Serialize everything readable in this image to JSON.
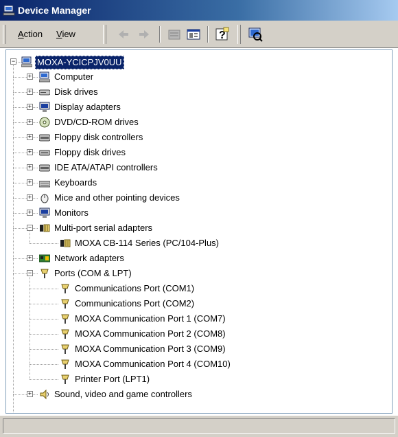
{
  "window": {
    "title": "Device Manager"
  },
  "toolbar": {
    "menu": [
      {
        "label": "Action",
        "accel": "A",
        "rest": "ction"
      },
      {
        "label": "View",
        "accel": "V",
        "rest": "iew"
      }
    ],
    "buttons": [
      "back-icon",
      "forward-icon",
      "up-folder-icon",
      "properties-icon",
      "help-icon",
      "scan-hardware-icon"
    ]
  },
  "tree": {
    "root": {
      "label": "MOXA-YCICPJV0UU",
      "icon": "computer-icon",
      "expanded": true,
      "selected": true
    },
    "nodes": [
      {
        "label": "Computer",
        "icon": "computer-icon",
        "expander": "+"
      },
      {
        "label": "Disk drives",
        "icon": "disk-drive-icon",
        "expander": "+"
      },
      {
        "label": "Display adapters",
        "icon": "monitor-icon",
        "expander": "+"
      },
      {
        "label": "DVD/CD-ROM drives",
        "icon": "cd-rom-icon",
        "expander": "+"
      },
      {
        "label": "Floppy disk controllers",
        "icon": "controller-icon",
        "expander": "+"
      },
      {
        "label": "Floppy disk drives",
        "icon": "floppy-drive-icon",
        "expander": "+"
      },
      {
        "label": "IDE ATA/ATAPI controllers",
        "icon": "controller-icon",
        "expander": "+"
      },
      {
        "label": "Keyboards",
        "icon": "keyboard-icon",
        "expander": "+"
      },
      {
        "label": "Mice and other pointing devices",
        "icon": "mouse-icon",
        "expander": "+"
      },
      {
        "label": "Monitors",
        "icon": "monitor-icon",
        "expander": "+"
      },
      {
        "label": "Multi-port serial adapters",
        "icon": "serial-adapter-icon",
        "expander": "-",
        "children": [
          {
            "label": "MOXA CB-114 Series (PC/104-Plus)",
            "icon": "serial-adapter-icon"
          }
        ]
      },
      {
        "label": "Network adapters",
        "icon": "network-card-icon",
        "expander": "+"
      },
      {
        "label": "Ports (COM & LPT)",
        "icon": "port-icon",
        "expander": "-",
        "children": [
          {
            "label": "Communications Port (COM1)",
            "icon": "port-icon"
          },
          {
            "label": "Communications Port (COM2)",
            "icon": "port-icon"
          },
          {
            "label": "MOXA Communication Port 1 (COM7)",
            "icon": "port-icon"
          },
          {
            "label": "MOXA Communication Port 2 (COM8)",
            "icon": "port-icon"
          },
          {
            "label": "MOXA Communication Port 3 (COM9)",
            "icon": "port-icon"
          },
          {
            "label": "MOXA Communication Port 4 (COM10)",
            "icon": "port-icon"
          },
          {
            "label": "Printer Port (LPT1)",
            "icon": "port-icon"
          }
        ]
      },
      {
        "label": "Sound, video and game controllers",
        "icon": "speaker-icon",
        "expander": "+"
      }
    ]
  },
  "statusbar": {
    "text": ""
  },
  "colors": {
    "title_start": "#0a246a",
    "title_end": "#a6caf0",
    "selection": "#0a246a",
    "chrome": "#d4d0c8"
  }
}
